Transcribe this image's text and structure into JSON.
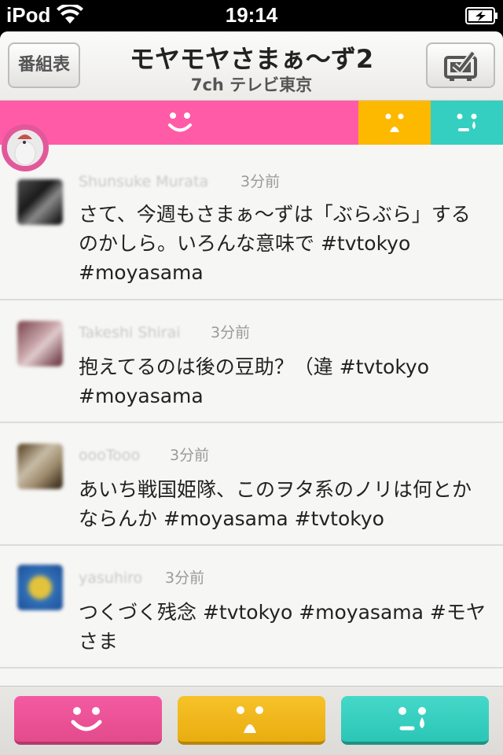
{
  "status_bar": {
    "carrier": "iPod",
    "time": "19:14"
  },
  "nav": {
    "left_button": "番組表",
    "title": "モヤモヤさまぁ〜ず2",
    "subtitle": "7ch テレビ東京"
  },
  "mood_colors": {
    "happy": "#ff5ba6",
    "worried": "#fdb800",
    "sad": "#34cfc0"
  },
  "icons": {
    "status": [
      "wifi-icon",
      "battery-charging-icon"
    ],
    "nav": [
      "tv-check-icon"
    ],
    "moods": [
      "smile-face-icon",
      "worried-face-icon",
      "crying-face-icon"
    ]
  },
  "tweets": [
    {
      "user": "Shunsuke Murata",
      "time": "3分前",
      "text": "さて、今週もさまぁ〜ずは「ぶらぶら」するのかしら。いろんな意味で #tvtokyo #moyasama"
    },
    {
      "user": "Takeshi Shirai",
      "time": "3分前",
      "text": "抱えてるのは後の豆助？（違 #tvtokyo #moyasama"
    },
    {
      "user": "oooTooo",
      "time": "3分前",
      "text": "あいち戦国姫隊、このヲタ系のノリは何とかならんか #moyasama #tvtokyo"
    },
    {
      "user": "yasuhiro",
      "time": "3分前",
      "text": "つくづく残念 #tvtokyo #moyasama #モヤさま"
    }
  ]
}
